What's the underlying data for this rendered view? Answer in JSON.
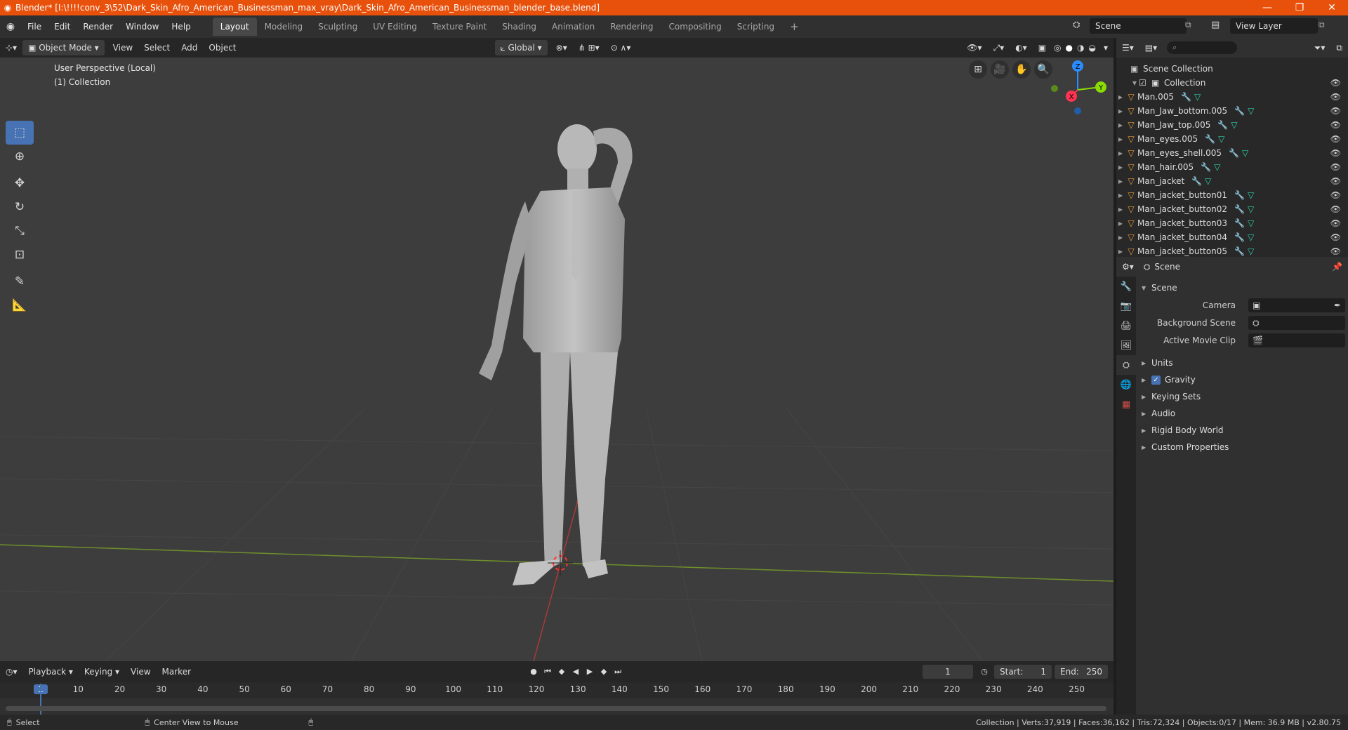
{
  "titlebar": {
    "title": "Blender* [I:\\!!!!conv_3\\52\\Dark_Skin_Afro_American_Businessman_max_vray\\Dark_Skin_Afro_American_Businessman_blender_base.blend]",
    "minimize": "—",
    "maximize": "❐",
    "close": "✕"
  },
  "topbar": {
    "menus": [
      "File",
      "Edit",
      "Render",
      "Window",
      "Help"
    ],
    "workspaces": [
      "Layout",
      "Modeling",
      "Sculpting",
      "UV Editing",
      "Texture Paint",
      "Shading",
      "Animation",
      "Rendering",
      "Compositing",
      "Scripting"
    ],
    "active_workspace": "Layout",
    "add_workspace": "+",
    "scene_name": "Scene",
    "view_layer": "View Layer"
  },
  "viewport_header": {
    "mode": "Object Mode",
    "menus": [
      "View",
      "Select",
      "Add",
      "Object"
    ],
    "orientation": "Global"
  },
  "viewport": {
    "perspective": "User Perspective (Local)",
    "collection": "(1) Collection",
    "gizmo": {
      "x": "X",
      "y": "Y",
      "z": "Z"
    }
  },
  "outliner": {
    "root": "Scene Collection",
    "collection": "Collection",
    "objects": [
      "Man.005",
      "Man_Jaw_bottom.005",
      "Man_Jaw_top.005",
      "Man_eyes.005",
      "Man_eyes_shell.005",
      "Man_hair.005",
      "Man_jacket",
      "Man_jacket_button01",
      "Man_jacket_button02",
      "Man_jacket_button03",
      "Man_jacket_button04",
      "Man_jacket_button05"
    ]
  },
  "properties": {
    "header": "Scene",
    "section": "Scene",
    "camera_label": "Camera",
    "background_scene_label": "Background Scene",
    "active_movie_clip_label": "Active Movie Clip",
    "subsections": [
      "Units",
      "Gravity",
      "Keying Sets",
      "Audio",
      "Rigid Body World",
      "Custom Properties"
    ],
    "gravity_checked": true
  },
  "timeline": {
    "menus": [
      "Playback",
      "Keying",
      "View",
      "Marker"
    ],
    "current_frame": "1",
    "start_label": "Start:",
    "start": "1",
    "end_label": "End:",
    "end": "250",
    "ruler": [
      "1",
      "10",
      "20",
      "30",
      "40",
      "50",
      "60",
      "70",
      "80",
      "90",
      "100",
      "110",
      "120",
      "130",
      "140",
      "150",
      "160",
      "170",
      "180",
      "190",
      "200",
      "210",
      "220",
      "230",
      "240",
      "250"
    ]
  },
  "statusbar": {
    "select": "Select",
    "center_view": "Center View to Mouse",
    "stats": "Collection | Verts:37,919 | Faces:36,162 | Tris:72,324 | Objects:0/17 | Mem: 36.9 MB | v2.80.75"
  },
  "colors": {
    "titlebar": "#e8510c",
    "accent": "#4772b3",
    "x_axis": "#ff3352",
    "y_axis": "#8bdc00",
    "z_axis": "#2b8cff"
  }
}
